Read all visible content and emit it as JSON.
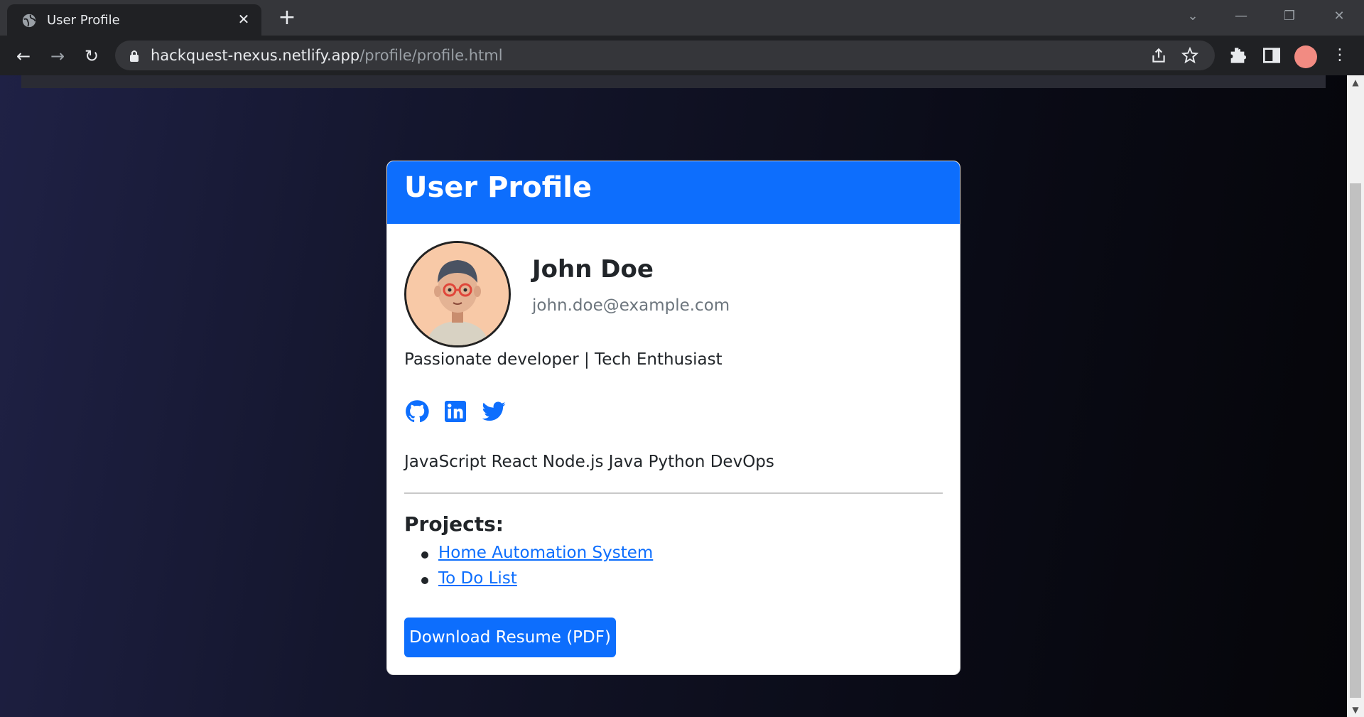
{
  "browser": {
    "tab_title": "User Profile",
    "tab_close": "✕",
    "new_tab": "+",
    "url_host": "hackquest-nexus.netlify.app",
    "url_path": "/profile/profile.html",
    "icons": [
      "globe-icon",
      "back-icon",
      "forward-icon",
      "reload-icon",
      "lock-icon",
      "share-icon",
      "star-icon",
      "extensions-icon",
      "sidepanel-icon",
      "profile-avatar",
      "menu-icon"
    ]
  },
  "profile": {
    "header_title": "User Profile",
    "name": "John Doe",
    "email": "john.doe@example.com",
    "bio": "Passionate developer | Tech Enthusiast",
    "social": [
      "github-icon",
      "linkedin-icon",
      "twitter-icon"
    ],
    "skills": "JavaScript React Node.js Java Python DevOps",
    "projects_title": "Projects:",
    "projects": [
      {
        "label": "Home Automation System"
      },
      {
        "label": "To Do List"
      }
    ],
    "download_label": "Download Resume (PDF)"
  },
  "colors": {
    "primary": "#0d6efd",
    "chrome_dark": "#202124",
    "tabbar": "#35363a"
  }
}
